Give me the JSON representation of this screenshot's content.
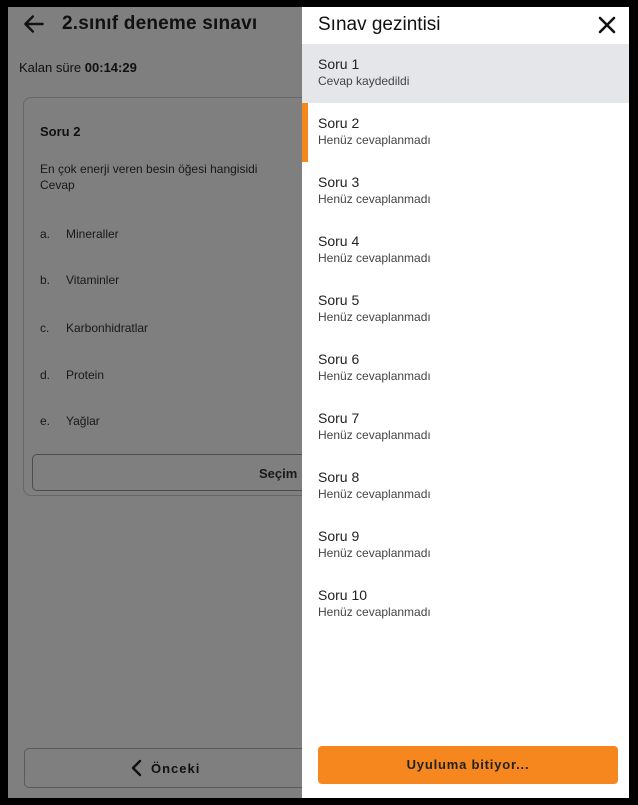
{
  "header": {
    "title": "2.sınıf deneme sınavı",
    "back_icon": "arrow-left-icon"
  },
  "timer": {
    "label": "Kalan süre",
    "value": "00:14:29"
  },
  "question": {
    "title": "Soru 2",
    "text": "En çok enerji veren besin öğesi hangisidi",
    "answer_label": "Cevap",
    "options": [
      {
        "letter": "a.",
        "text": "Mineraller"
      },
      {
        "letter": "b.",
        "text": "Vitaminler"
      },
      {
        "letter": "c.",
        "text": "Karbonhidratlar"
      },
      {
        "letter": "d.",
        "text": "Protein"
      },
      {
        "letter": "e.",
        "text": "Yağlar"
      }
    ],
    "select_label": "Seçim"
  },
  "footer": {
    "prev_label": "Önceki"
  },
  "drawer": {
    "title": "Sınav gezintisi",
    "items": [
      {
        "name": "Soru 1",
        "status": "Cevap kaydedildi"
      },
      {
        "name": "Soru 2",
        "status": "Henüz cevaplanmadı"
      },
      {
        "name": "Soru 3",
        "status": "Henüz cevaplanmadı"
      },
      {
        "name": "Soru 4",
        "status": "Henüz cevaplanmadı"
      },
      {
        "name": "Soru 5",
        "status": "Henüz cevaplanmadı"
      },
      {
        "name": "Soru 6",
        "status": "Henüz cevaplanmadı"
      },
      {
        "name": "Soru 7",
        "status": "Henüz cevaplanmadı"
      },
      {
        "name": "Soru 8",
        "status": "Henüz cevaplanmadı"
      },
      {
        "name": "Soru 9",
        "status": "Henüz cevaplanmadı"
      },
      {
        "name": "Soru 10",
        "status": "Henüz cevaplanmadı"
      }
    ],
    "finish_label": "Uyuluma bitiyor..."
  },
  "colors": {
    "accent": "#f6871f",
    "answered_bg": "#e4e6e9",
    "overlay": "#808080"
  }
}
